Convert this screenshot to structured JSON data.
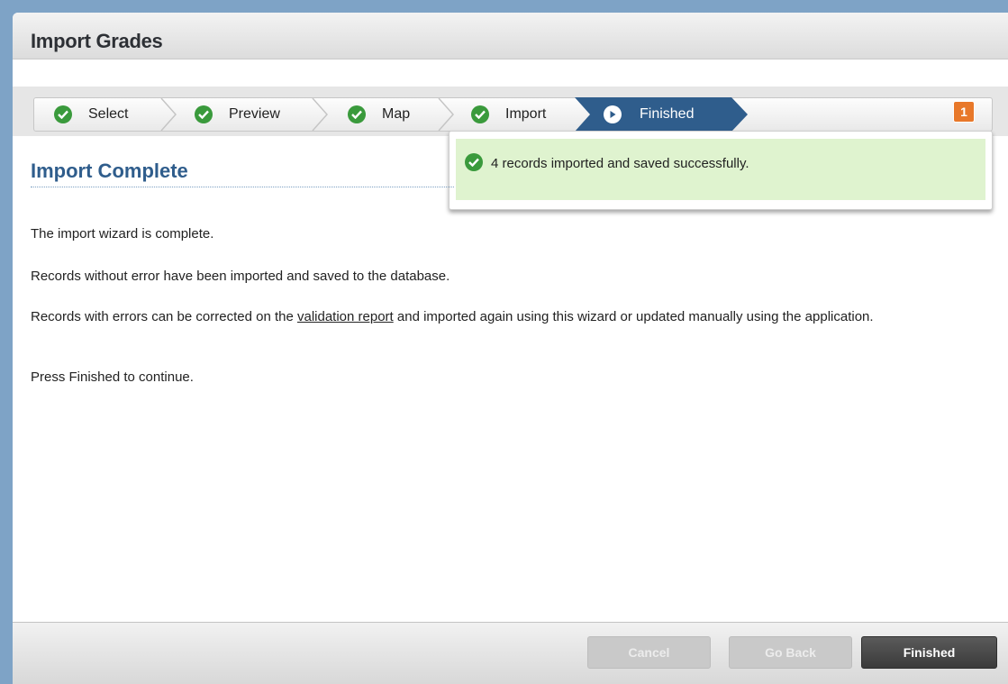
{
  "dialog": {
    "title": "Import Grades"
  },
  "wizard": {
    "steps": [
      {
        "label": "Select",
        "state": "complete",
        "icon": "check-circle-icon"
      },
      {
        "label": "Preview",
        "state": "complete",
        "icon": "check-circle-icon"
      },
      {
        "label": "Map",
        "state": "complete",
        "icon": "check-circle-icon"
      },
      {
        "label": "Import",
        "state": "complete",
        "icon": "check-circle-icon"
      },
      {
        "label": "Finished",
        "state": "active",
        "icon": "play-circle-icon"
      }
    ],
    "notification_count": "1"
  },
  "notification": {
    "message": "4 records imported and saved successfully.",
    "icon": "check-circle-icon"
  },
  "main": {
    "heading": "Import Complete",
    "p1": "The import wizard is complete.",
    "p2": "Records without error have been imported and saved to the database.",
    "p3_before": "Records with errors can be corrected on the ",
    "p3_link": "validation report",
    "p3_after": " and imported again using this wizard or updated manually using the application.",
    "p4": "Press Finished to continue."
  },
  "footer": {
    "cancel_label": "Cancel",
    "back_label": "Go Back",
    "finish_label": "Finished"
  },
  "colors": {
    "success": "#3a9a3c",
    "success_bg": "#dff3cf",
    "active_step": "#2f5d8c",
    "badge": "#e8782a",
    "heading": "#2f5d8c"
  }
}
